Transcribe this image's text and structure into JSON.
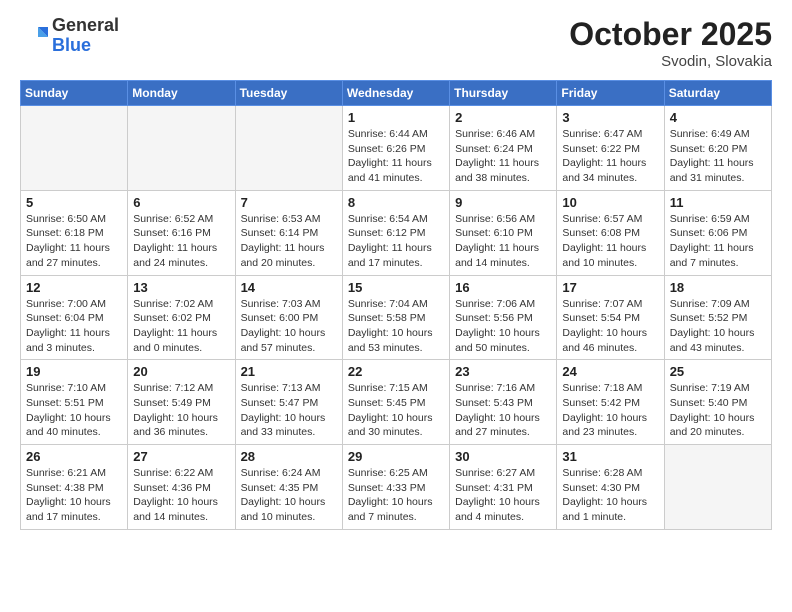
{
  "logo": {
    "general": "General",
    "blue": "Blue"
  },
  "title": "October 2025",
  "location": "Svodin, Slovakia",
  "days_of_week": [
    "Sunday",
    "Monday",
    "Tuesday",
    "Wednesday",
    "Thursday",
    "Friday",
    "Saturday"
  ],
  "weeks": [
    [
      {
        "day": "",
        "info": ""
      },
      {
        "day": "",
        "info": ""
      },
      {
        "day": "",
        "info": ""
      },
      {
        "day": "1",
        "info": "Sunrise: 6:44 AM\nSunset: 6:26 PM\nDaylight: 11 hours\nand 41 minutes."
      },
      {
        "day": "2",
        "info": "Sunrise: 6:46 AM\nSunset: 6:24 PM\nDaylight: 11 hours\nand 38 minutes."
      },
      {
        "day": "3",
        "info": "Sunrise: 6:47 AM\nSunset: 6:22 PM\nDaylight: 11 hours\nand 34 minutes."
      },
      {
        "day": "4",
        "info": "Sunrise: 6:49 AM\nSunset: 6:20 PM\nDaylight: 11 hours\nand 31 minutes."
      }
    ],
    [
      {
        "day": "5",
        "info": "Sunrise: 6:50 AM\nSunset: 6:18 PM\nDaylight: 11 hours\nand 27 minutes."
      },
      {
        "day": "6",
        "info": "Sunrise: 6:52 AM\nSunset: 6:16 PM\nDaylight: 11 hours\nand 24 minutes."
      },
      {
        "day": "7",
        "info": "Sunrise: 6:53 AM\nSunset: 6:14 PM\nDaylight: 11 hours\nand 20 minutes."
      },
      {
        "day": "8",
        "info": "Sunrise: 6:54 AM\nSunset: 6:12 PM\nDaylight: 11 hours\nand 17 minutes."
      },
      {
        "day": "9",
        "info": "Sunrise: 6:56 AM\nSunset: 6:10 PM\nDaylight: 11 hours\nand 14 minutes."
      },
      {
        "day": "10",
        "info": "Sunrise: 6:57 AM\nSunset: 6:08 PM\nDaylight: 11 hours\nand 10 minutes."
      },
      {
        "day": "11",
        "info": "Sunrise: 6:59 AM\nSunset: 6:06 PM\nDaylight: 11 hours\nand 7 minutes."
      }
    ],
    [
      {
        "day": "12",
        "info": "Sunrise: 7:00 AM\nSunset: 6:04 PM\nDaylight: 11 hours\nand 3 minutes."
      },
      {
        "day": "13",
        "info": "Sunrise: 7:02 AM\nSunset: 6:02 PM\nDaylight: 11 hours\nand 0 minutes."
      },
      {
        "day": "14",
        "info": "Sunrise: 7:03 AM\nSunset: 6:00 PM\nDaylight: 10 hours\nand 57 minutes."
      },
      {
        "day": "15",
        "info": "Sunrise: 7:04 AM\nSunset: 5:58 PM\nDaylight: 10 hours\nand 53 minutes."
      },
      {
        "day": "16",
        "info": "Sunrise: 7:06 AM\nSunset: 5:56 PM\nDaylight: 10 hours\nand 50 minutes."
      },
      {
        "day": "17",
        "info": "Sunrise: 7:07 AM\nSunset: 5:54 PM\nDaylight: 10 hours\nand 46 minutes."
      },
      {
        "day": "18",
        "info": "Sunrise: 7:09 AM\nSunset: 5:52 PM\nDaylight: 10 hours\nand 43 minutes."
      }
    ],
    [
      {
        "day": "19",
        "info": "Sunrise: 7:10 AM\nSunset: 5:51 PM\nDaylight: 10 hours\nand 40 minutes."
      },
      {
        "day": "20",
        "info": "Sunrise: 7:12 AM\nSunset: 5:49 PM\nDaylight: 10 hours\nand 36 minutes."
      },
      {
        "day": "21",
        "info": "Sunrise: 7:13 AM\nSunset: 5:47 PM\nDaylight: 10 hours\nand 33 minutes."
      },
      {
        "day": "22",
        "info": "Sunrise: 7:15 AM\nSunset: 5:45 PM\nDaylight: 10 hours\nand 30 minutes."
      },
      {
        "day": "23",
        "info": "Sunrise: 7:16 AM\nSunset: 5:43 PM\nDaylight: 10 hours\nand 27 minutes."
      },
      {
        "day": "24",
        "info": "Sunrise: 7:18 AM\nSunset: 5:42 PM\nDaylight: 10 hours\nand 23 minutes."
      },
      {
        "day": "25",
        "info": "Sunrise: 7:19 AM\nSunset: 5:40 PM\nDaylight: 10 hours\nand 20 minutes."
      }
    ],
    [
      {
        "day": "26",
        "info": "Sunrise: 6:21 AM\nSunset: 4:38 PM\nDaylight: 10 hours\nand 17 minutes."
      },
      {
        "day": "27",
        "info": "Sunrise: 6:22 AM\nSunset: 4:36 PM\nDaylight: 10 hours\nand 14 minutes."
      },
      {
        "day": "28",
        "info": "Sunrise: 6:24 AM\nSunset: 4:35 PM\nDaylight: 10 hours\nand 10 minutes."
      },
      {
        "day": "29",
        "info": "Sunrise: 6:25 AM\nSunset: 4:33 PM\nDaylight: 10 hours\nand 7 minutes."
      },
      {
        "day": "30",
        "info": "Sunrise: 6:27 AM\nSunset: 4:31 PM\nDaylight: 10 hours\nand 4 minutes."
      },
      {
        "day": "31",
        "info": "Sunrise: 6:28 AM\nSunset: 4:30 PM\nDaylight: 10 hours\nand 1 minute."
      },
      {
        "day": "",
        "info": ""
      }
    ]
  ]
}
